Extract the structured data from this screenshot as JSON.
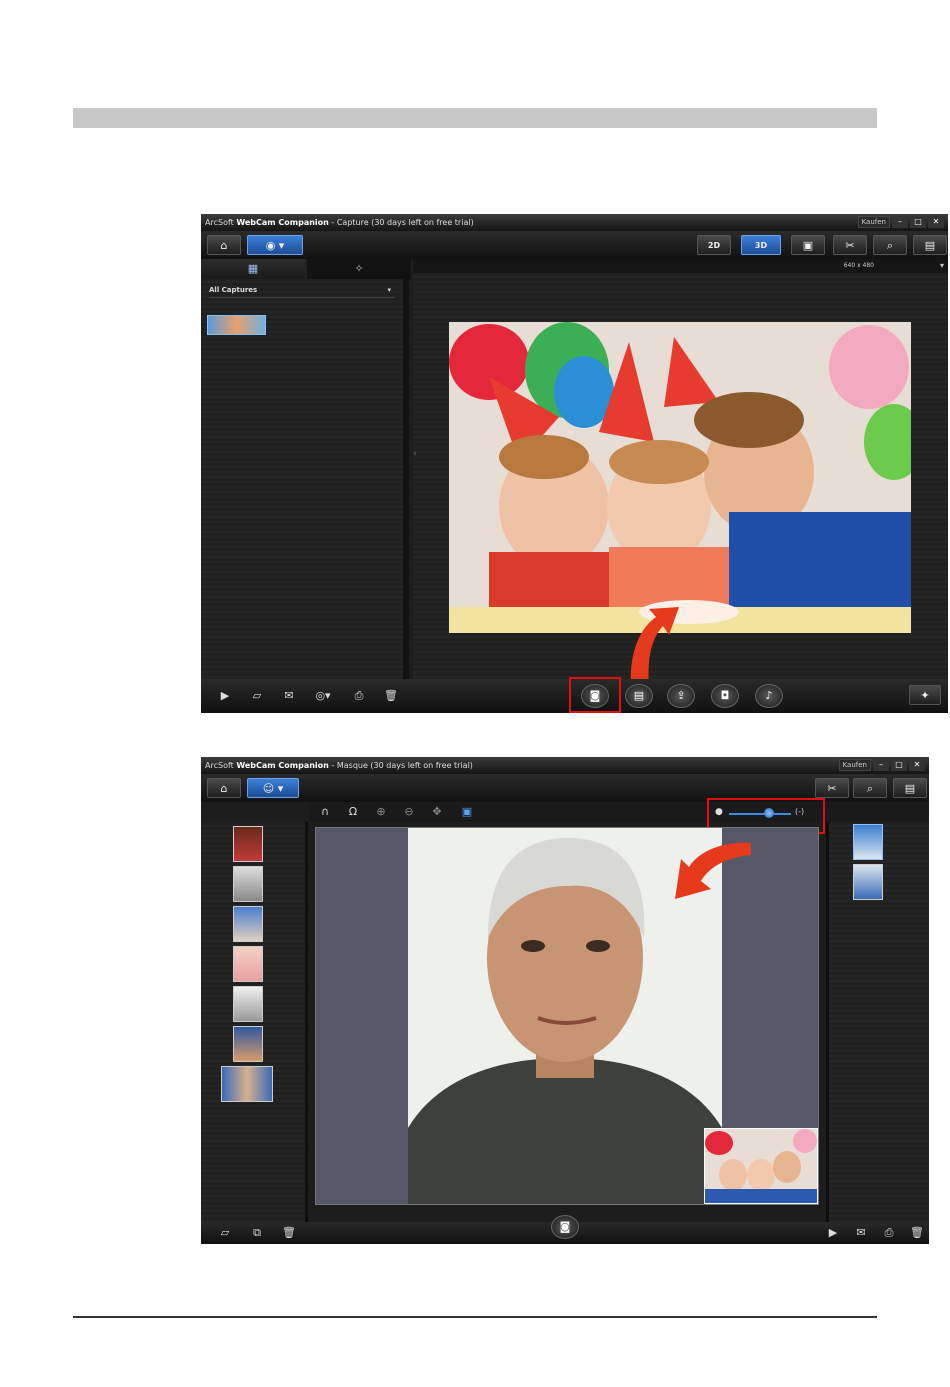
{
  "window1": {
    "title_prefix": "ArcSoft",
    "title_app": "WebCam Companion",
    "title_rest": " - Capture (30 days left on free trial)",
    "buy_label": "Kaufen",
    "toolbar_2d": "2D",
    "toolbar_3d": "3D",
    "resolution": "640 x 480",
    "album_label": "All Captures"
  },
  "window2": {
    "title_prefix": "ArcSoft",
    "title_app": "WebCam Companion",
    "title_rest": " - Masque (30 days left on free trial)",
    "buy_label": "Kaufen"
  },
  "colors": {
    "highlight": "#e01010",
    "accent_blue": "#2f6fc8",
    "window_bg": "#1d1d1d"
  },
  "icons": {
    "home": "home-icon",
    "capture_mode": "webcam-mode-icon",
    "mask_mode": "mask-mode-icon",
    "camera": "camera-shutter-icon",
    "settings": "tools-icon",
    "search": "search-icon",
    "folder": "folder-icon",
    "print": "print-icon",
    "trash": "trash-icon"
  }
}
